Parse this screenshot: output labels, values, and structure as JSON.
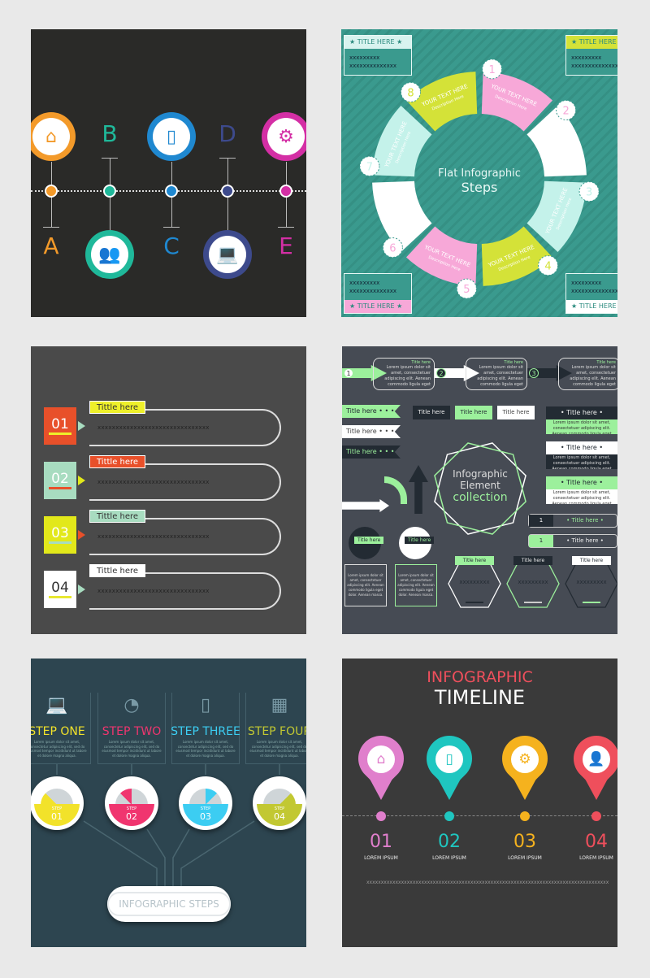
{
  "panel1": {
    "bg": "#2a2a28",
    "items": [
      {
        "letter": "A",
        "icon": "home-icon",
        "color": "#f39a2a"
      },
      {
        "letter": "B",
        "icon": "users-icon",
        "color": "#1fb89a"
      },
      {
        "letter": "C",
        "icon": "smartphone-icon",
        "color": "#1f88d0"
      },
      {
        "letter": "D",
        "icon": "laptop-icon",
        "color": "#3d4a8c"
      },
      {
        "letter": "E",
        "icon": "gear-icon",
        "color": "#d42fa5"
      }
    ]
  },
  "panel2": {
    "bg": "#3a9a8e",
    "center_title": "Flat Infographic",
    "center_subtitle": "Steps",
    "segments": [
      {
        "number": "1",
        "title": "YOUR TEXT HERE",
        "desc": "Description Here",
        "color": "#f7a8d8"
      },
      {
        "number": "2",
        "title": "YOUR TEXT HERE",
        "desc": "Description Here",
        "color": "#ffffff"
      },
      {
        "number": "3",
        "title": "YOUR TEXT HERE",
        "desc": "Description Here",
        "color": "#c4f2ea"
      },
      {
        "number": "4",
        "title": "YOUR TEXT HERE",
        "desc": "Description Here",
        "color": "#d4e238"
      },
      {
        "number": "5",
        "title": "YOUR TEXT HERE",
        "desc": "Description Here",
        "color": "#f7a8d8"
      },
      {
        "number": "6",
        "title": "YOUR TEXT HERE",
        "desc": "Description Here",
        "color": "#ffffff"
      },
      {
        "number": "7",
        "title": "YOUR TEXT HERE",
        "desc": "Description Here",
        "color": "#c4f2ea"
      },
      {
        "number": "8",
        "title": "YOUR TEXT HERE",
        "desc": "Description Here",
        "color": "#d4e238"
      }
    ],
    "callouts": [
      {
        "title": "TITLE HERE",
        "line1": "xxxxxxxxx",
        "line2": "xxxxxxxxxxxxxx",
        "color": "#d8f3ef"
      },
      {
        "title": "TITLE HERE",
        "line1": "xxxxxxxxx",
        "line2": "xxxxxxxxxxxxxx",
        "color": "#d4e238"
      },
      {
        "title": "TITLE HERE",
        "line1": "xxxxxxxxx",
        "line2": "xxxxxxxxxxxxxx",
        "color": "#f7a8d8"
      },
      {
        "title": "TITLE HERE",
        "line1": "xxxxxxxxx",
        "line2": "xxxxxxxxxxxxxx",
        "color": "#ffffff"
      }
    ]
  },
  "panel3": {
    "bg": "#4a4a4a",
    "rows": [
      {
        "number": "01",
        "label": "Tittle here",
        "text": "xxxxxxxxxxxxxxxxxxxxxxxxxxxxxxx",
        "color": "#e8502a",
        "tag_color": "#eef02a",
        "arrow_color": "#a8dcc0"
      },
      {
        "number": "02",
        "label": "Tittle here",
        "text": "xxxxxxxxxxxxxxxxxxxxxxxxxxxxxxx",
        "color": "#a8dcc0",
        "tag_color": "#e8502a",
        "arrow_color": "#e2e81a"
      },
      {
        "number": "03",
        "label": "Tittle here",
        "text": "xxxxxxxxxxxxxxxxxxxxxxxxxxxxxxx",
        "color": "#e2e81a",
        "tag_color": "#a8dcc0",
        "arrow_color": "#e8502a"
      },
      {
        "number": "04",
        "label": "Tittle here",
        "text": "xxxxxxxxxxxxxxxxxxxxxxxxxxxxxxx",
        "color": "#ffffff",
        "tag_color": "#ffffff",
        "arrow_color": "#a8dcc0"
      }
    ]
  },
  "panel4": {
    "bg": "#464b54",
    "accent": "#9cf09c",
    "dark": "#232b33",
    "title": "Title here",
    "lorem": "Lorem ipsum dolor sit amet, consectetuer adipiscing elit. Aenean commodo ligula eget dolor. Aenean massa.",
    "steps": [
      "1",
      "2",
      "3"
    ],
    "center": [
      "Infographic",
      "Element",
      "collection"
    ],
    "num": "1",
    "xs": "xxxxxxxxx"
  },
  "panel5": {
    "bg": "#2d4550",
    "footer": "INFOGRAPHIC STEPS",
    "step_word": "STEP",
    "lorem": "Lorem ipsum dolor sit amet, consectetur adipiscing elit, sed do eiusmod tempor incididunt ut labore et dolore magna aliqua.",
    "steps": [
      {
        "title": "STEP ONE",
        "num": "01",
        "icon": "laptop-icon",
        "color": "#f2e22a"
      },
      {
        "title": "STEP TWO",
        "num": "02",
        "icon": "wifi-icon",
        "color": "#f0356f"
      },
      {
        "title": "STEP THREE",
        "num": "03",
        "icon": "smartphone-icon",
        "color": "#3ccdf2"
      },
      {
        "title": "STEP FOUR",
        "num": "04",
        "icon": "grid-icon",
        "color": "#c2c832"
      }
    ]
  },
  "panel6": {
    "bg": "#3a3a3a",
    "title1": "INFOGRAPHIC",
    "title2": "TIMELINE",
    "title1_color": "#ef4f5c",
    "footer": "xxxxxxxxxxxxxxxxxxxxxxxxxxxxxxxxxxxxxxxxxxxxxxxxxxxxxxxxxxxxxxxxxxxxxxxxxxxxxxxxxxxx",
    "items": [
      {
        "num": "01",
        "label": "LOREM IPSUM",
        "icon": "home-icon",
        "color": "#e07fcc"
      },
      {
        "num": "02",
        "label": "LOREM IPSUM",
        "icon": "smartphone-icon",
        "color": "#1fc6c0"
      },
      {
        "num": "03",
        "label": "LOREM IPSUM",
        "icon": "gear-icon",
        "color": "#f5b21e"
      },
      {
        "num": "04",
        "label": "LOREM IPSUM",
        "icon": "user-icon",
        "color": "#ef4f5c"
      }
    ]
  }
}
